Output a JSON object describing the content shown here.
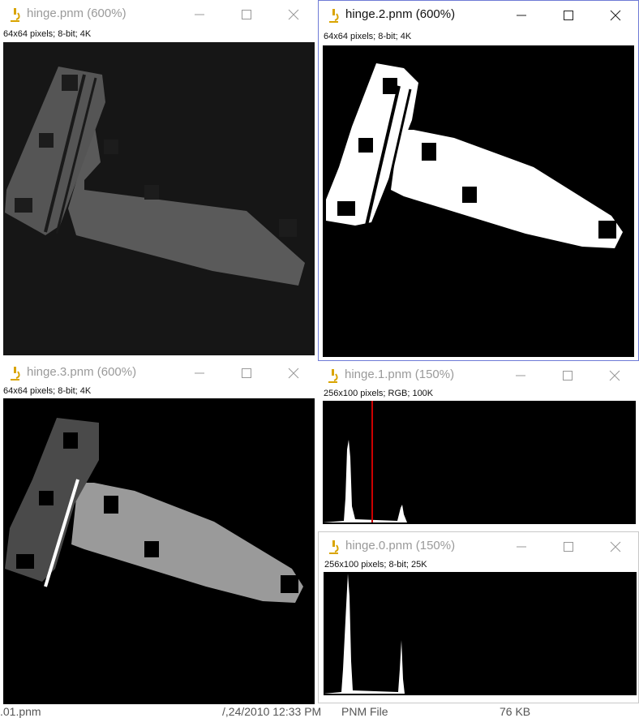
{
  "windows": [
    {
      "id": "hinge",
      "title": "hinge.pnm (600%)",
      "info": "64x64 pixels; 8-bit; 4K"
    },
    {
      "id": "hinge2",
      "title": "hinge.2.pnm (600%)",
      "info": "64x64 pixels; 8-bit; 4K"
    },
    {
      "id": "hinge3",
      "title": "hinge.3.pnm (600%)",
      "info": "64x64 pixels; 8-bit; 4K"
    },
    {
      "id": "hinge1",
      "title": "hinge.1.pnm (150%)",
      "info": "256x100 pixels; RGB; 100K"
    },
    {
      "id": "hinge0",
      "title": "hinge.0.pnm (150%)",
      "info": "256x100 pixels; 8-bit; 25K"
    }
  ],
  "icons": {
    "app": "microscope-icon",
    "minimize": "minimize-icon",
    "maximize": "maximize-icon",
    "close": "close-icon"
  },
  "colors": {
    "active_border": "#6f7bd6",
    "histogram_marker": "#cc0000",
    "background_image": "#000000"
  },
  "statusbar": {
    "name_fragment": ".01.pnm",
    "date_fragment": "/,24/2010 12:33 PM",
    "type": "PNM File",
    "size": "76 KB"
  }
}
